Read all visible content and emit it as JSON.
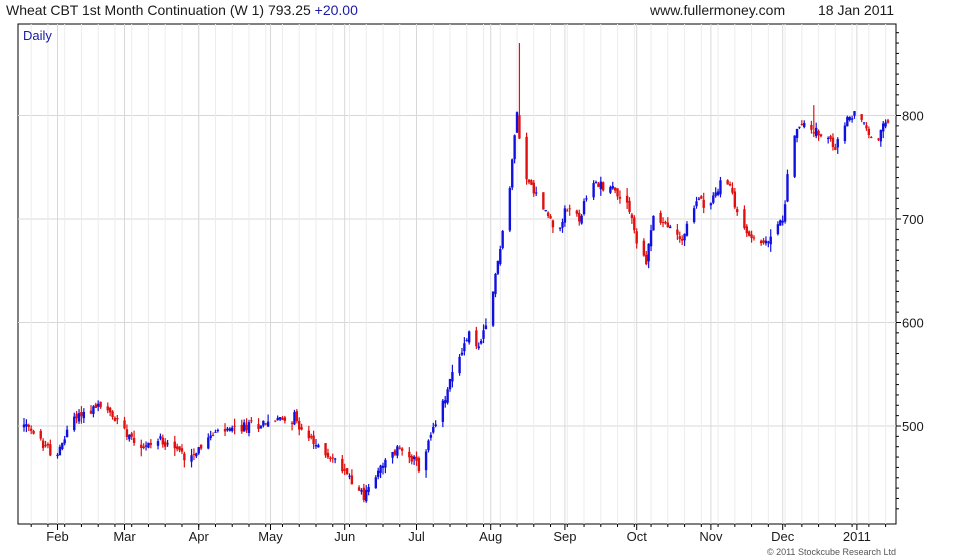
{
  "header": {
    "title": "Wheat CBT 1st Month Continuation (W 1) 793.25",
    "change": "+20.00",
    "source": "www.fullermoney.com",
    "date": "18 Jan 2011"
  },
  "footer": {
    "copyright": "© 2011 Stockcube Research Ltd"
  },
  "chart_data": {
    "type": "candlestick",
    "interval_label": "Daily",
    "y_axis": {
      "position": "right",
      "ticks": [
        500,
        600,
        700,
        800
      ],
      "range": [
        415,
        880
      ]
    },
    "x_axis": {
      "labels": [
        "Feb",
        "Mar",
        "Apr",
        "May",
        "Jun",
        "Jul",
        "Aug",
        "Sep",
        "Oct",
        "Nov",
        "Dec",
        "2011"
      ],
      "label_days": [
        14,
        42,
        73,
        103,
        134,
        164,
        195,
        226,
        256,
        287,
        317,
        348
      ],
      "days_visible": [
        0,
        361
      ]
    },
    "grid": true,
    "colors": {
      "up": "#1010e0",
      "down": "#e01010",
      "grid": "#d8d8d8",
      "frame": "#000000"
    },
    "price_path": [
      [
        0,
        500
      ],
      [
        14,
        470
      ],
      [
        20,
        508
      ],
      [
        32,
        520
      ],
      [
        42,
        498
      ],
      [
        50,
        480
      ],
      [
        58,
        488
      ],
      [
        68,
        470
      ],
      [
        80,
        493
      ],
      [
        90,
        498
      ],
      [
        103,
        505
      ],
      [
        113,
        508
      ],
      [
        121,
        482
      ],
      [
        128,
        470
      ],
      [
        136,
        453
      ],
      [
        142,
        432
      ],
      [
        148,
        455
      ],
      [
        156,
        478
      ],
      [
        160,
        478
      ],
      [
        165,
        458
      ],
      [
        170,
        490
      ],
      [
        175,
        520
      ],
      [
        180,
        558
      ],
      [
        186,
        590
      ],
      [
        190,
        575
      ],
      [
        194,
        600
      ],
      [
        198,
        660
      ],
      [
        203,
        730
      ],
      [
        206,
        805
      ],
      [
        208,
        755
      ],
      [
        211,
        735
      ],
      [
        216,
        715
      ],
      [
        222,
        690
      ],
      [
        228,
        712
      ],
      [
        232,
        700
      ],
      [
        238,
        735
      ],
      [
        246,
        730
      ],
      [
        253,
        712
      ],
      [
        257,
        665
      ],
      [
        260,
        660
      ],
      [
        263,
        703
      ],
      [
        268,
        695
      ],
      [
        275,
        680
      ],
      [
        282,
        722
      ],
      [
        286,
        712
      ],
      [
        293,
        740
      ],
      [
        296,
        725
      ],
      [
        300,
        690
      ],
      [
        306,
        680
      ],
      [
        310,
        675
      ],
      [
        317,
        700
      ],
      [
        321,
        780
      ],
      [
        327,
        795
      ],
      [
        333,
        778
      ],
      [
        339,
        770
      ],
      [
        344,
        795
      ],
      [
        348,
        805
      ],
      [
        352,
        785
      ],
      [
        356,
        772
      ],
      [
        360,
        793
      ]
    ],
    "spikes": [
      {
        "day": 207,
        "high": 870
      },
      {
        "day": 349,
        "high": 823
      },
      {
        "day": 330,
        "high": 810
      }
    ],
    "last_close": 793.25
  }
}
